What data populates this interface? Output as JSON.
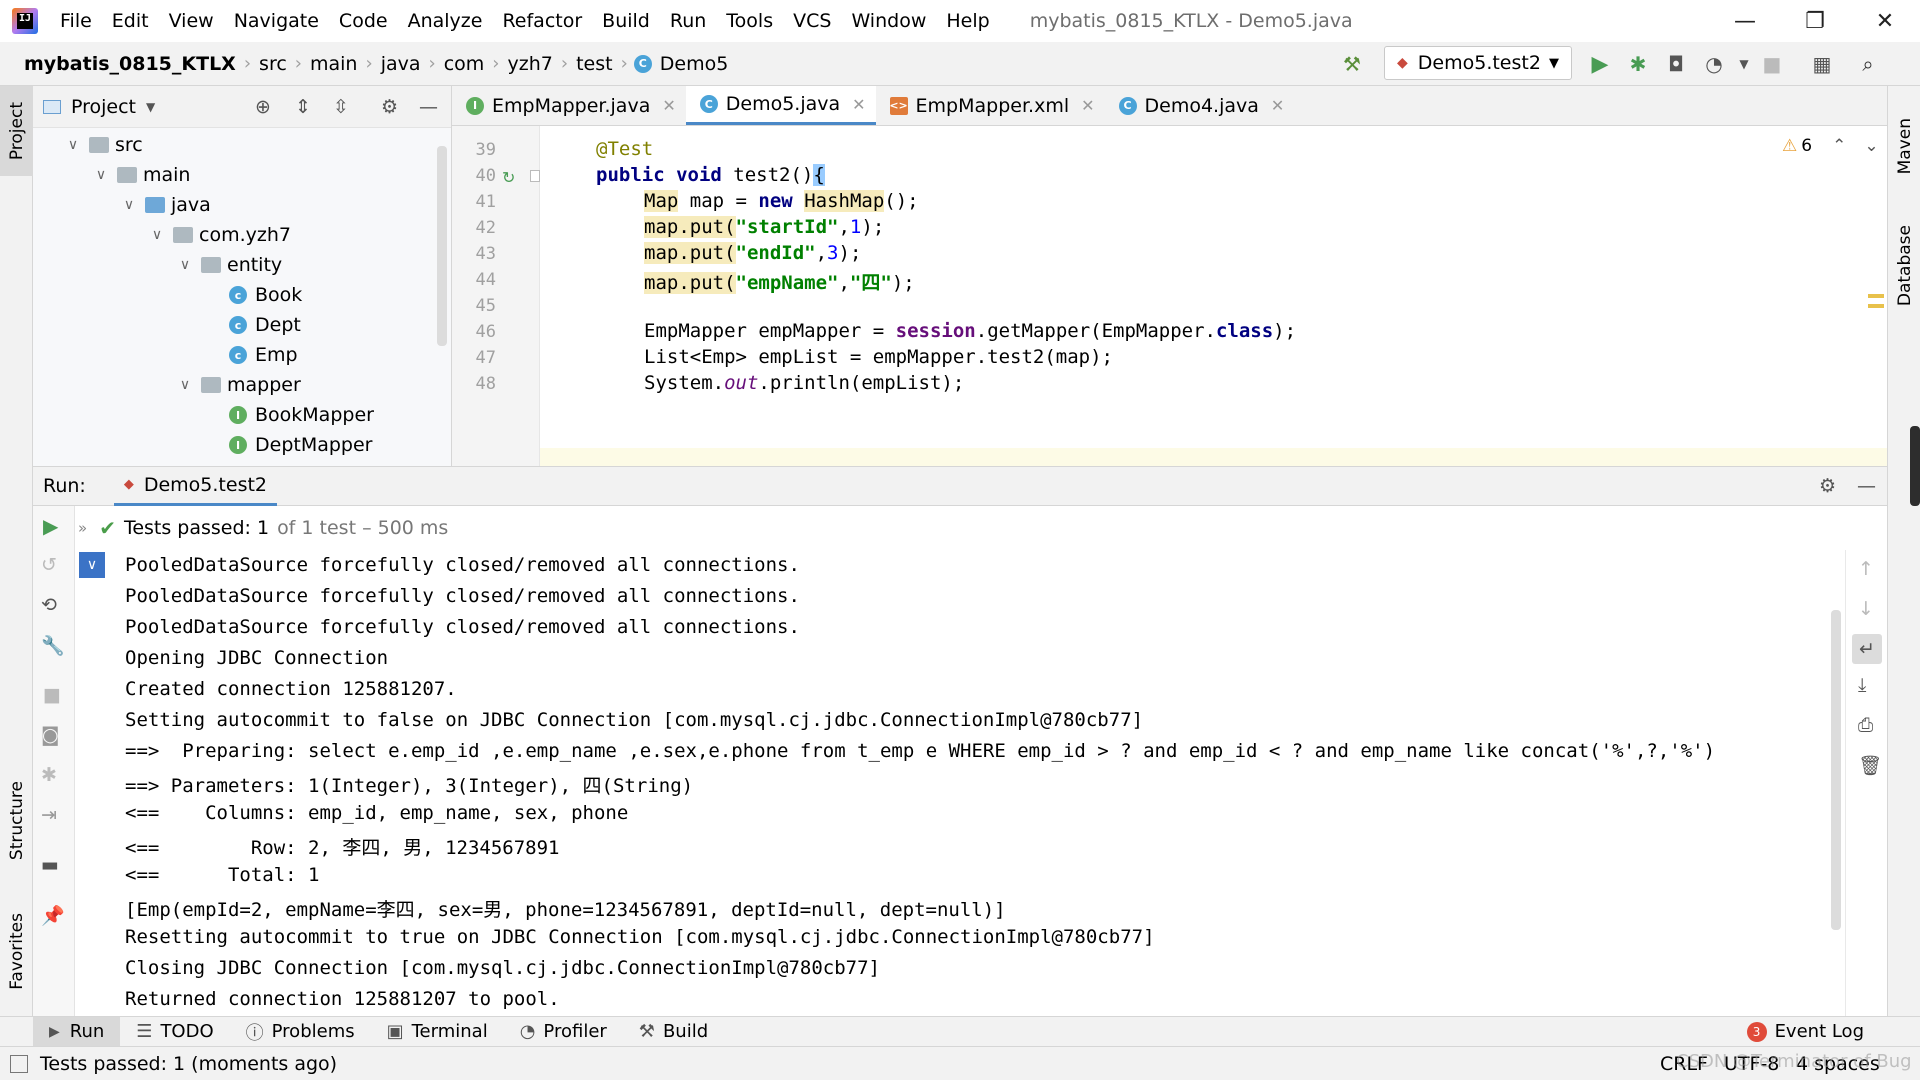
{
  "menu": {
    "items": [
      "File",
      "Edit",
      "View",
      "Navigate",
      "Code",
      "Analyze",
      "Refactor",
      "Build",
      "Run",
      "Tools",
      "VCS",
      "Window",
      "Help"
    ],
    "window_title": "mybatis_0815_KTLX - Demo5.java"
  },
  "breadcrumb": {
    "project": "mybatis_0815_KTLX",
    "parts": [
      "src",
      "main",
      "java",
      "com",
      "yzh7",
      "test",
      "Demo5"
    ]
  },
  "run_config": {
    "label": "Demo5.test2"
  },
  "left_strip": {
    "project": "Project",
    "structure": "Structure",
    "favorites": "Favorites"
  },
  "right_strip": {
    "maven": "Maven",
    "database": "Database"
  },
  "project_panel": {
    "title": "Project",
    "tree": [
      {
        "label": "src"
      },
      {
        "label": "main"
      },
      {
        "label": "java"
      },
      {
        "label": "com.yzh7"
      },
      {
        "label": "entity"
      },
      {
        "label": "Book"
      },
      {
        "label": "Dept"
      },
      {
        "label": "Emp"
      },
      {
        "label": "mapper"
      },
      {
        "label": "BookMapper"
      },
      {
        "label": "DeptMapper"
      }
    ]
  },
  "editor_tabs": [
    {
      "label": "EmpMapper.java"
    },
    {
      "label": "Demo5.java"
    },
    {
      "label": "EmpMapper.xml"
    },
    {
      "label": "Demo4.java"
    }
  ],
  "editor": {
    "warning_count": "6",
    "line_numbers": [
      "39",
      "40",
      "41",
      "42",
      "43",
      "44",
      "45",
      "46",
      "47",
      "48"
    ],
    "annotation": "@Test",
    "sig": {
      "kw1": "public",
      "kw2": "void",
      "rest": " test2()",
      "brace": "{"
    },
    "l41": {
      "t1": "Map",
      "t2": " map = ",
      "kw": "new",
      "t3": " ",
      "t4": "HashMap",
      "t5": "();"
    },
    "l42": {
      "call": "map.put(",
      "s": "\"startId\"",
      "c": ",",
      "n": "1",
      "e": ");"
    },
    "l43": {
      "call": "map.put(",
      "s": "\"endId\"",
      "c": ",",
      "n": "3",
      "e": ");"
    },
    "l44": {
      "call": "map.put(",
      "s": "\"empName\"",
      "c": ",",
      "s2": "\"四\"",
      "e": ");"
    },
    "l46": {
      "a": "EmpMapper empMapper = ",
      "f": "session",
      "b": ".getMapper(EmpMapper.",
      "k": "class",
      "c": ");"
    },
    "l47": {
      "a": "List<Emp> empList = empMapper.test2(map);"
    },
    "l48": {
      "a": "System.",
      "o": "out",
      "b": ".println(empList);"
    }
  },
  "run_panel": {
    "label": "Run:",
    "tab": "Demo5.test2",
    "status_prefix": "Tests passed:",
    "status_count": "1",
    "status_rest": "of 1 test – 500 ms"
  },
  "console": [
    "PooledDataSource forcefully closed/removed all connections.",
    "PooledDataSource forcefully closed/removed all connections.",
    "PooledDataSource forcefully closed/removed all connections.",
    "Opening JDBC Connection",
    "Created connection 125881207.",
    "Setting autocommit to false on JDBC Connection [com.mysql.cj.jdbc.ConnectionImpl@780cb77]",
    "==>  Preparing: select e.emp_id ,e.emp_name ,e.sex,e.phone from t_emp e WHERE emp_id > ? and emp_id < ? and emp_name like concat('%',?,'%')",
    "==> Parameters: 1(Integer), 3(Integer), 四(String)",
    "<==    Columns: emp_id, emp_name, sex, phone",
    "<==        Row: 2, 李四, 男, 1234567891",
    "<==      Total: 1",
    "[Emp(empId=2, empName=李四, sex=男, phone=1234567891, deptId=null, dept=null)]",
    "Resetting autocommit to true on JDBC Connection [com.mysql.cj.jdbc.ConnectionImpl@780cb77]",
    "Closing JDBC Connection [com.mysql.cj.jdbc.ConnectionImpl@780cb77]",
    "Returned connection 125881207 to pool."
  ],
  "bottom_tabs": [
    {
      "label": "Run"
    },
    {
      "label": "TODO"
    },
    {
      "label": "Problems"
    },
    {
      "label": "Terminal"
    },
    {
      "label": "Profiler"
    },
    {
      "label": "Build"
    }
  ],
  "event_log": {
    "label": "Event Log",
    "badge": "3"
  },
  "status_bar": {
    "message": "Tests passed: 1 (moments ago)",
    "line_sep": "CRLF",
    "encoding": "UTF-8",
    "indent": "4 spaces",
    "watermark": "CSDN @Terminator of Bug"
  },
  "colors": {
    "accent": "#4a88c7",
    "pass_green": "#4a9d4a",
    "run_green": "#499c54"
  }
}
